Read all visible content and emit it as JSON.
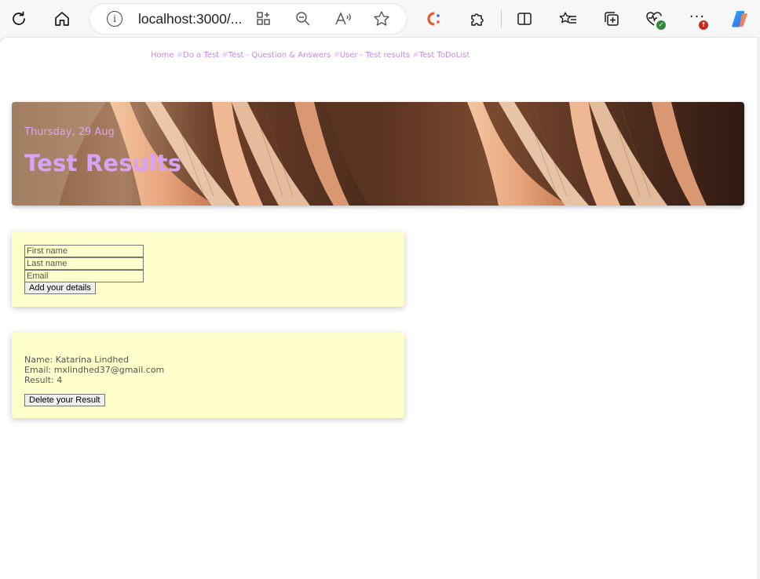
{
  "browser": {
    "url": "localhost:3000/...",
    "notification_badge": "↑"
  },
  "nav": {
    "links": [
      {
        "label": "Home",
        "hash": ""
      },
      {
        "label": "Do a Test",
        "hash": "#"
      },
      {
        "label": "Test - Question & Answers",
        "hash": "#"
      },
      {
        "label": "User - Test results",
        "hash": "#"
      },
      {
        "label": "Test ToDoList",
        "hash": "#"
      }
    ]
  },
  "hero": {
    "date": "Thursday, 29 Aug",
    "title": "Test Results"
  },
  "form": {
    "first_name_placeholder": "First name",
    "last_name_placeholder": "Last name",
    "email_placeholder": "Email",
    "submit_label": "Add your details"
  },
  "result": {
    "name_line": "Name: Katarina Lindhed",
    "email_line": "Email: mxlindhed37@gmail.com",
    "result_line": "Result: 4",
    "delete_label": "Delete your Result"
  },
  "colors": {
    "accent": "#d7a3f7",
    "card_bg": "#ffffcc",
    "nav_link": "#c58ae6"
  },
  "icons": [
    "refresh-icon",
    "home-icon",
    "info-icon",
    "app-available-icon",
    "zoom-out-icon",
    "read-aloud-icon",
    "favorite-star-icon",
    "coupons-extension-icon",
    "extensions-puzzle-icon",
    "split-screen-icon",
    "favorites-icon",
    "collections-icon",
    "browser-essentials-icon",
    "more-menu-icon",
    "copilot-icon"
  ]
}
